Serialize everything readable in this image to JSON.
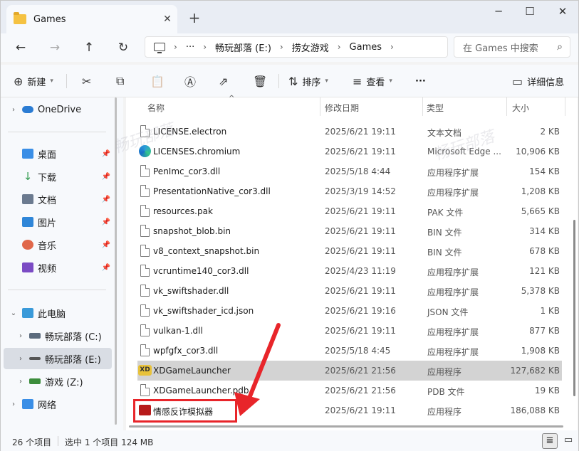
{
  "window": {
    "tab_title": "Games",
    "close_tab_glyph": "✕",
    "new_tab_glyph": "+",
    "minimize_glyph": "─",
    "maximize_glyph": "☐",
    "close_glyph": "✕"
  },
  "nav": {
    "back_glyph": "←",
    "forward_glyph": "→",
    "up_glyph": "↑",
    "refresh_glyph": "↻"
  },
  "address": {
    "more_glyph": "···",
    "crumbs": [
      "畅玩部落 (E:)",
      "捞女游戏",
      "Games"
    ],
    "sep_glyph": "›"
  },
  "search": {
    "placeholder": "在 Games 中搜索",
    "icon_glyph": "⌕"
  },
  "toolbar": {
    "new_label": "新建",
    "new_glyph": "⊕",
    "cut_glyph": "✂",
    "copy_glyph": "⧉",
    "paste_glyph": "📋",
    "rename_glyph": "Ⓐ",
    "share_glyph": "⇗",
    "delete_glyph": "🗑",
    "sort_label": "排序",
    "sort_glyph": "⇅",
    "view_label": "查看",
    "view_glyph": "≡",
    "more_glyph": "···",
    "details_label": "详细信息",
    "details_glyph": "▭"
  },
  "sidebar": {
    "onedrive": "OneDrive",
    "quick": [
      {
        "label": "桌面",
        "color": "#3a8ee6"
      },
      {
        "label": "下载",
        "color": "#2e9a4c"
      },
      {
        "label": "文档",
        "color": "#6b7a8f"
      },
      {
        "label": "图片",
        "color": "#2f86d8"
      },
      {
        "label": "音乐",
        "color": "#e0674a"
      },
      {
        "label": "视频",
        "color": "#7b4bc4"
      }
    ],
    "this_pc": "此电脑",
    "drives": [
      "畅玩部落 (C:)",
      "畅玩部落 (E:)",
      "游戏 (Z:)"
    ],
    "network": "网络"
  },
  "columns": {
    "name": "名称",
    "modified": "修改日期",
    "type": "类型",
    "size": "大小"
  },
  "files": [
    {
      "name": "LICENSE.electron",
      "date": "2025/6/21 19:11",
      "type": "文本文档",
      "size": "2 KB"
    },
    {
      "name": "LICENSES.chromium",
      "date": "2025/6/21 19:11",
      "type": "Microsoft Edge ...",
      "size": "10,906 KB"
    },
    {
      "name": "PenImc_cor3.dll",
      "date": "2025/5/18 4:44",
      "type": "应用程序扩展",
      "size": "154 KB"
    },
    {
      "name": "PresentationNative_cor3.dll",
      "date": "2025/3/19 14:52",
      "type": "应用程序扩展",
      "size": "1,208 KB"
    },
    {
      "name": "resources.pak",
      "date": "2025/6/21 19:11",
      "type": "PAK 文件",
      "size": "5,665 KB"
    },
    {
      "name": "snapshot_blob.bin",
      "date": "2025/6/21 19:11",
      "type": "BIN 文件",
      "size": "314 KB"
    },
    {
      "name": "v8_context_snapshot.bin",
      "date": "2025/6/21 19:11",
      "type": "BIN 文件",
      "size": "678 KB"
    },
    {
      "name": "vcruntime140_cor3.dll",
      "date": "2025/4/23 11:19",
      "type": "应用程序扩展",
      "size": "121 KB"
    },
    {
      "name": "vk_swiftshader.dll",
      "date": "2025/6/21 19:11",
      "type": "应用程序扩展",
      "size": "5,378 KB"
    },
    {
      "name": "vk_swiftshader_icd.json",
      "date": "2025/6/21 19:16",
      "type": "JSON 文件",
      "size": "1 KB"
    },
    {
      "name": "vulkan-1.dll",
      "date": "2025/6/21 19:11",
      "type": "应用程序扩展",
      "size": "877 KB"
    },
    {
      "name": "wpfgfx_cor3.dll",
      "date": "2025/5/18 4:45",
      "type": "应用程序扩展",
      "size": "1,908 KB"
    },
    {
      "name": "XDGameLauncher",
      "date": "2025/6/21 21:56",
      "type": "应用程序",
      "size": "127,682 KB"
    },
    {
      "name": "XDGameLauncher.pdb",
      "date": "2025/6/21 21:56",
      "type": "PDB 文件",
      "size": "19 KB"
    },
    {
      "name": "情感反诈模拟器",
      "date": "2025/6/21 19:11",
      "type": "应用程序",
      "size": "186,088 KB"
    }
  ],
  "status": {
    "count": "26 个项目",
    "selected": "选中 1 个项目  124 MB"
  },
  "watermark": "畅玩部落",
  "accent": "#e8252a"
}
